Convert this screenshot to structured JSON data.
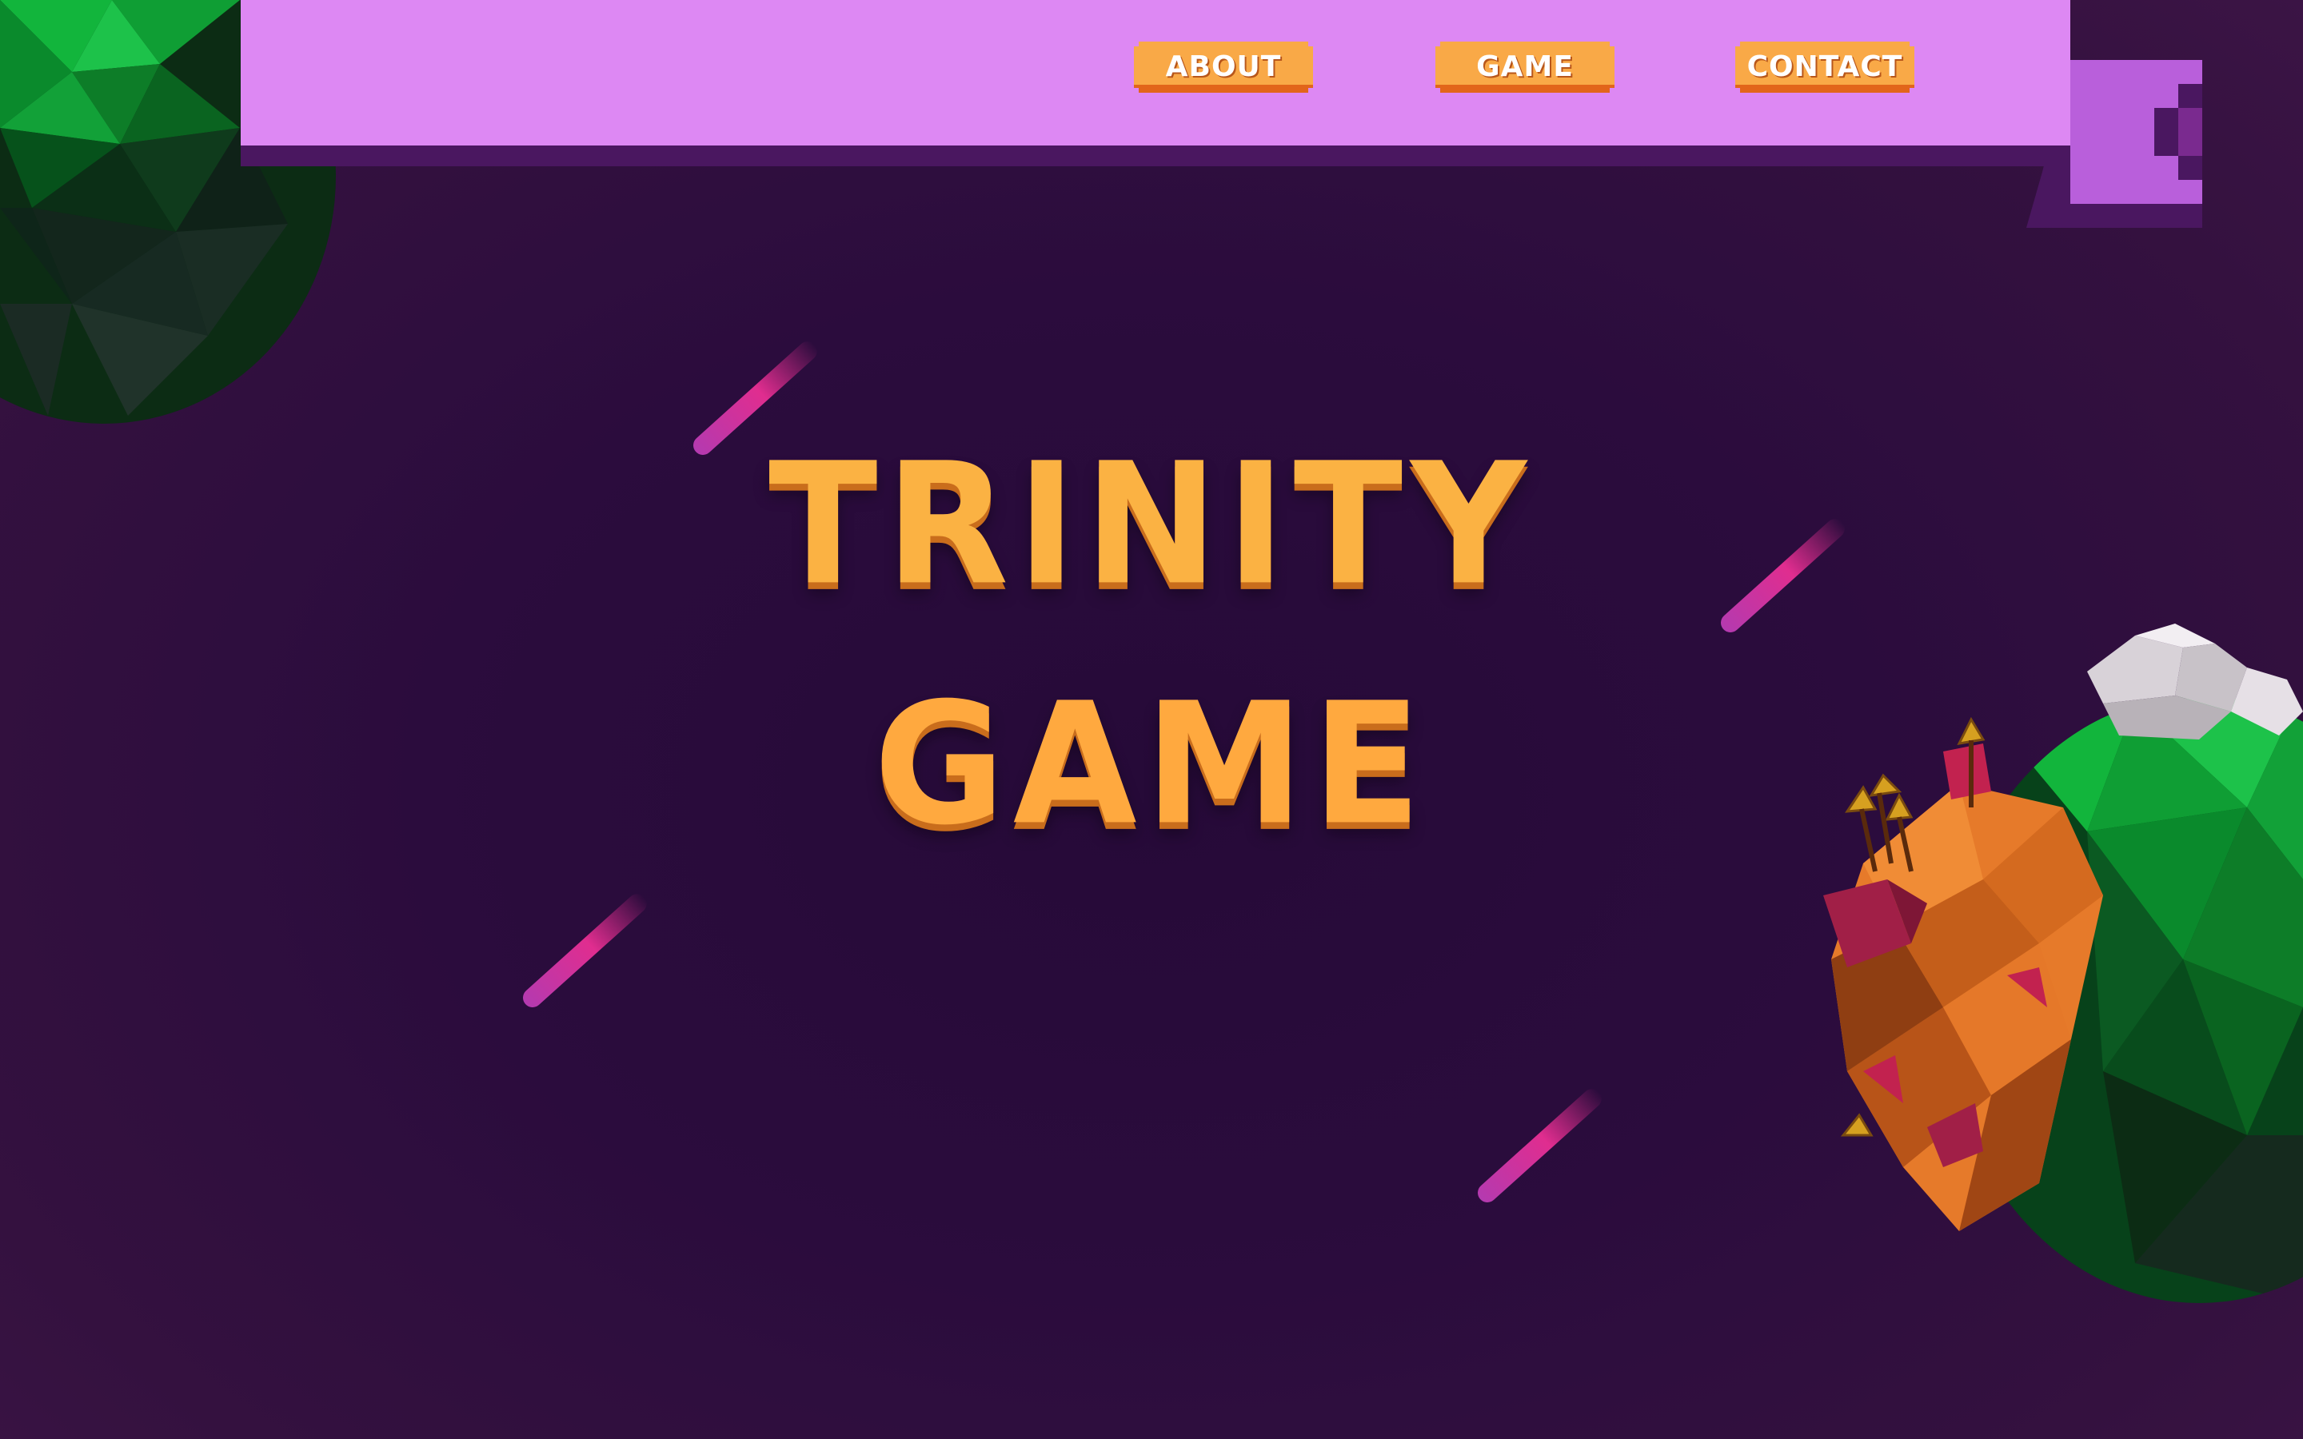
{
  "nav": {
    "items": [
      {
        "label": "ABOUT"
      },
      {
        "label": "GAME"
      },
      {
        "label": "CONTACT"
      }
    ]
  },
  "hero": {
    "line1": "TRINITY",
    "line2": "GAME"
  },
  "colors": {
    "background": "#2b0c3d",
    "header": "#dd88f3",
    "header_shadow": "#4a1760",
    "ribbon_tail": "#b95fdb",
    "button": "#f9a947",
    "button_edge": "#e2651a",
    "title": "#fbb243",
    "streak_pink": "#e02d8f",
    "planet_green": "#12b53c",
    "planet_orange": "#e67a2a"
  },
  "icons": {
    "left_planet": "low-poly-planet-icon",
    "right_planet": "low-poly-island-planet-icon",
    "streak": "meteor-streak-icon"
  }
}
